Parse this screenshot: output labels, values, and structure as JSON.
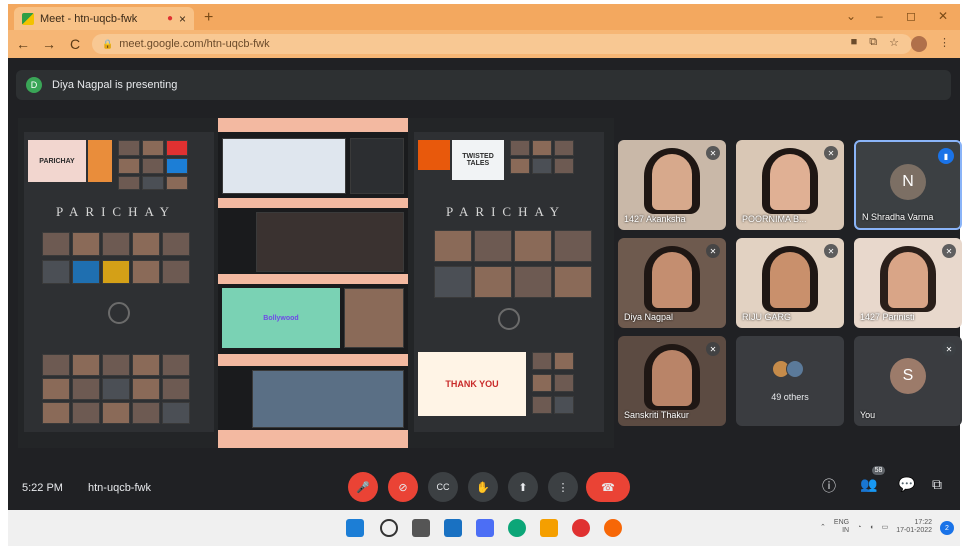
{
  "browser": {
    "tab_title": "Meet - htn-uqcb-fwk",
    "tab_close": "×",
    "new_tab": "+",
    "url": "meet.google.com/htn-uqcb-fwk",
    "back": "←",
    "forward": "→",
    "reload": "C",
    "minimize": "–",
    "maximize": "◻",
    "close": "✕",
    "collapse": "⌄"
  },
  "meet": {
    "banner": "Diya Nagpal is presenting",
    "banner_initial": "D",
    "slides": {
      "title_left": "PARICHAY",
      "title_right": "PARICHAY",
      "card_parichay": "PARICHAY",
      "card_twisted": "TWISTED TALES",
      "card_bollywood": "Bollywood",
      "card_thankyou": "THANK YOU"
    },
    "participants": [
      {
        "name": "1427 Akanksha"
      },
      {
        "name": "POORNIMA B..."
      },
      {
        "name": "N Shradha Varma",
        "initial": "N"
      },
      {
        "name": "Diya Nagpal"
      },
      {
        "name": "RIJU GARG"
      },
      {
        "name": "1427 Parinisti"
      },
      {
        "name": "Sanskriti Thakur"
      },
      {
        "name": "49 others"
      },
      {
        "name": "You",
        "initial": "S"
      }
    ],
    "time": "5:22 PM",
    "code": "htn-uqcb-fwk",
    "people_count": "58",
    "controls": {
      "mic": "🎤",
      "cam": "⊘",
      "cc": "CC",
      "hand": "✋",
      "present": "⬆",
      "more": "⋮",
      "hangup": "☎",
      "info": "ⓘ",
      "people": "👥",
      "chat": "💬",
      "activities": "⧉"
    }
  },
  "taskbar": {
    "lang": "ENG",
    "lang2": "IN",
    "clock_time": "17:22",
    "clock_date": "17-01-2022",
    "notif": "2"
  },
  "colors": {
    "chrome": "#f3a85f",
    "meet_bg": "#202124",
    "hangup": "#ea4335",
    "accent": "#8ab4f8"
  }
}
